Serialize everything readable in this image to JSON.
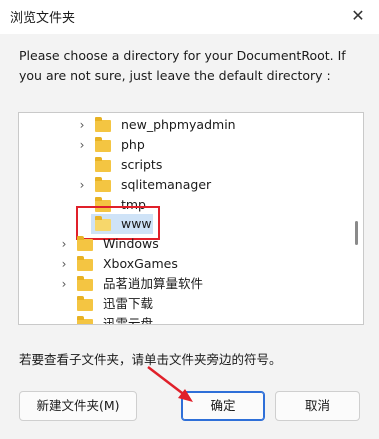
{
  "dialog": {
    "title": "浏览文件夹",
    "close_icon": "close-icon",
    "instruction": "Please choose a directory for your DocumentRoot. If you are not sure, just leave the default directory :",
    "hint": "若要查看子文件夹，请单击文件夹旁边的符号。"
  },
  "tree": {
    "items": [
      {
        "label": "new_phpmyadmin",
        "expandable": true
      },
      {
        "label": "php",
        "expandable": true
      },
      {
        "label": "scripts",
        "expandable": false
      },
      {
        "label": "sqlitemanager",
        "expandable": true
      },
      {
        "label": "tmp",
        "expandable": false
      },
      {
        "label": "www",
        "expandable": false,
        "selected": true
      },
      {
        "label": "Windows",
        "expandable": true
      },
      {
        "label": "XboxGames",
        "expandable": true
      },
      {
        "label": "品茗逍加算量软件",
        "expandable": true
      },
      {
        "label": "迅雷下载",
        "expandable": false
      },
      {
        "label": "迅雷云盘",
        "expandable": false
      }
    ]
  },
  "buttons": {
    "new_folder": "新建文件夹(M)",
    "ok": "确定",
    "cancel": "取消"
  },
  "colors": {
    "highlight": "#e0202a",
    "folder": "#f4c542",
    "selection": "#cfe3f7",
    "primary_border": "#2e6fd8"
  }
}
